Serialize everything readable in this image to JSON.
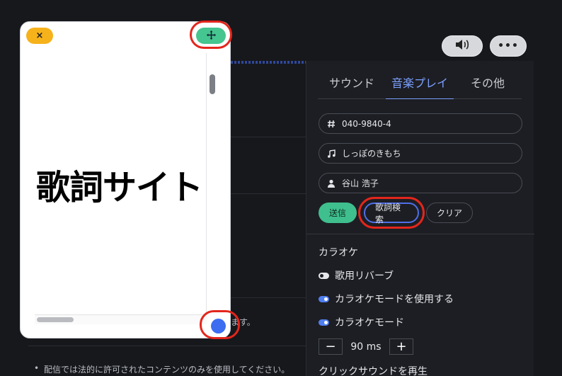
{
  "toolbar": {
    "volume_icon": "volume-icon",
    "more_label": "•••"
  },
  "panel": {
    "tabs": [
      {
        "label": "サウンド",
        "active": false
      },
      {
        "label": "音楽プレイ",
        "active": true
      },
      {
        "label": "その他",
        "active": false
      }
    ],
    "fields": {
      "number": {
        "value": "040-9840-4",
        "icon": "hash-icon"
      },
      "song": {
        "value": "しっぽのきもち",
        "icon": "music-note-icon"
      },
      "artist": {
        "value": "谷山 浩子",
        "icon": "person-icon"
      }
    },
    "buttons": {
      "send": "送信",
      "lyrics_search": "歌詞検索",
      "clear": "クリア"
    },
    "karaoke": {
      "title": "カラオケ",
      "toggles": [
        {
          "label": "歌用リバーブ",
          "on": false
        },
        {
          "label": "カラオケモードを使用する",
          "on": true
        },
        {
          "label": "カラオケモード",
          "on": true
        }
      ],
      "delay": {
        "value": "90 ms",
        "minus": "−",
        "plus": "+"
      }
    },
    "click_sound_title": "クリックサウンドを再生"
  },
  "overlay": {
    "close_label": "×",
    "title": "歌詞サイト"
  },
  "background": {
    "notice": "配信では法的に許可されたコンテンツのみを使用してください。",
    "fragment": "ます。"
  },
  "colors": {
    "accent": "#7ba0ff",
    "send": "#3fbf8e",
    "close": "#f6b21a",
    "move": "#45c58f",
    "highlight": "#e3261c"
  }
}
